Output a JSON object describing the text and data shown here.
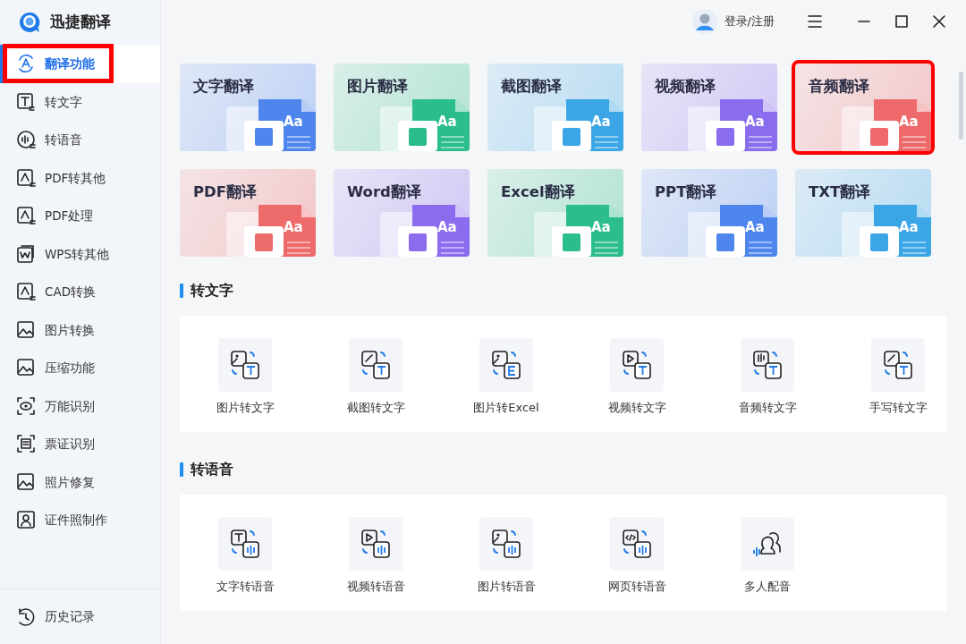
{
  "app": {
    "title": "迅捷翻译"
  },
  "sidebar": {
    "items": [
      {
        "label": "翻译功能",
        "kind": "translate",
        "selected": true,
        "highlighted": true
      },
      {
        "label": "转文字",
        "kind": "text",
        "selected": false,
        "highlighted": false
      },
      {
        "label": "转语音",
        "kind": "voice",
        "selected": false,
        "highlighted": false
      },
      {
        "label": "PDF转其他",
        "kind": "pdf",
        "selected": false,
        "highlighted": false
      },
      {
        "label": "PDF处理",
        "kind": "pdf",
        "selected": false,
        "highlighted": false
      },
      {
        "label": "WPS转其他",
        "kind": "wps",
        "selected": false,
        "highlighted": false
      },
      {
        "label": "CAD转换",
        "kind": "pdf",
        "selected": false,
        "highlighted": false
      },
      {
        "label": "图片转换",
        "kind": "image",
        "selected": false,
        "highlighted": false
      },
      {
        "label": "压缩功能",
        "kind": "image",
        "selected": false,
        "highlighted": false
      },
      {
        "label": "万能识别",
        "kind": "eye",
        "selected": false,
        "highlighted": false
      },
      {
        "label": "票证识别",
        "kind": "scan",
        "selected": false,
        "highlighted": false
      },
      {
        "label": "照片修复",
        "kind": "image",
        "selected": false,
        "highlighted": false
      },
      {
        "label": "证件照制作",
        "kind": "id",
        "selected": false,
        "highlighted": false
      }
    ],
    "footer_item": {
      "label": "历史记录"
    }
  },
  "topbar": {
    "login": "登录/注册"
  },
  "translate_cards": [
    {
      "label": "文字翻译",
      "badge": "Aa",
      "color": "#4f86ee",
      "highlighted": false
    },
    {
      "label": "图片翻译",
      "badge": "Aa",
      "color": "#2bbd8a",
      "highlighted": false
    },
    {
      "label": "截图翻译",
      "badge": "Aa",
      "color": "#3ba6e6",
      "highlighted": false
    },
    {
      "label": "视频翻译",
      "badge": "Aa",
      "color": "#8a6cef",
      "highlighted": false
    },
    {
      "label": "音频翻译",
      "badge": "Aa",
      "color": "#ee6a6a",
      "highlighted": true
    },
    {
      "label": "PDF翻译",
      "badge": "Aa",
      "color": "#ee6b6b",
      "highlighted": false
    },
    {
      "label": "Word翻译",
      "badge": "Aa",
      "color": "#8b6cef",
      "highlighted": false
    },
    {
      "label": "Excel翻译",
      "badge": "Aa",
      "color": "#2bbd8a",
      "highlighted": false
    },
    {
      "label": "PPT翻译",
      "badge": "Aa",
      "color": "#4f86ee",
      "highlighted": false
    },
    {
      "label": "TXT翻译",
      "badge": "Aa",
      "color": "#3ba6e6",
      "highlighted": false
    }
  ],
  "sections": [
    {
      "title": "转文字",
      "tools": [
        {
          "label": "图片转文字",
          "kind": "image-text"
        },
        {
          "label": "截图转文字",
          "kind": "pen-text"
        },
        {
          "label": "图片转Excel",
          "kind": "image-excel"
        },
        {
          "label": "视频转文字",
          "kind": "video-text"
        },
        {
          "label": "音频转文字",
          "kind": "audio-text"
        },
        {
          "label": "手写转文字",
          "kind": "pen-text"
        }
      ]
    },
    {
      "title": "转语音",
      "tools": [
        {
          "label": "文字转语音",
          "kind": "text-voice"
        },
        {
          "label": "视频转语音",
          "kind": "video-voice"
        },
        {
          "label": "图片转语音",
          "kind": "image-voice"
        },
        {
          "label": "网页转语音",
          "kind": "web-voice"
        },
        {
          "label": "多人配音",
          "kind": "multi"
        }
      ]
    }
  ]
}
